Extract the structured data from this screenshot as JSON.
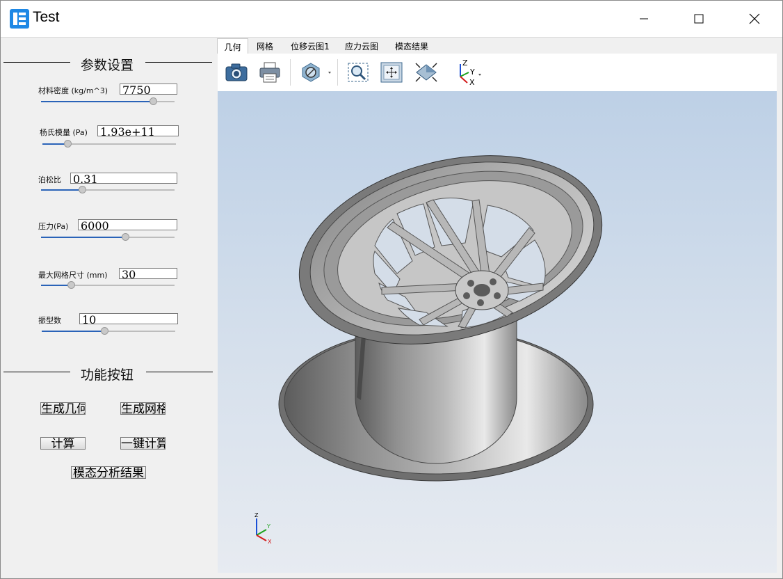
{
  "window": {
    "title": "Test"
  },
  "params": {
    "section_title": "参数设置",
    "items": [
      {
        "label": "材料密度 (kg/m^3)",
        "value": "7750",
        "slider_fraction": 0.86
      },
      {
        "label": "杨氏模量 (Pa)",
        "value": "1.93e+11",
        "slider_fraction": 0.17
      },
      {
        "label": "泊松比",
        "value": "0.31",
        "slider_fraction": 0.3
      },
      {
        "label": "压力(Pa)",
        "value": "6000",
        "slider_fraction": 0.64
      },
      {
        "label": "最大网格尺寸 (mm)",
        "value": "30",
        "slider_fraction": 0.21
      },
      {
        "label": "振型数",
        "value": "10",
        "slider_fraction": 0.47
      }
    ]
  },
  "functions": {
    "section_title": "功能按钮",
    "gen_geometry": "生成几何",
    "gen_mesh": "生成网格",
    "compute": "计算",
    "one_click": "一键计算",
    "modal_result": "模态分析结果"
  },
  "tabs": [
    "几何",
    "网格",
    "位移云图1",
    "应力云图",
    "模态结果"
  ],
  "toolbar": {
    "icons": [
      "camera-icon",
      "print-icon",
      "display-mode-icon",
      "zoom-box-icon",
      "fit-all-icon",
      "view-fit-icon",
      "axes-orientation-icon"
    ],
    "axis_labels": {
      "z": "Z",
      "y": "Y",
      "x": "X"
    }
  },
  "viewport": {
    "triad": {
      "z": "Z",
      "y": "Y",
      "x": "X"
    }
  },
  "colors": {
    "accent": "#2a63b8",
    "viewport_top": "#bdd0e6",
    "viewport_bottom": "#e7ebf1"
  }
}
